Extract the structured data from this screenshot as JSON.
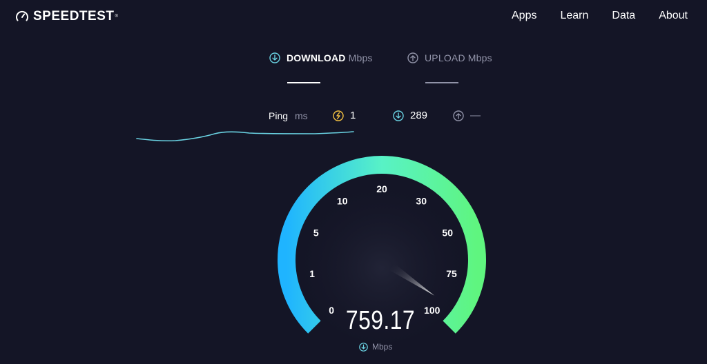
{
  "brand": {
    "name": "SPEEDTEST"
  },
  "nav": {
    "items": [
      "Apps",
      "Learn",
      "Data",
      "About"
    ]
  },
  "tabs": {
    "download": {
      "title": "DOWNLOAD",
      "unit": "Mbps",
      "icon": "download-arrow-icon"
    },
    "upload": {
      "title": "UPLOAD",
      "unit": "Mbps",
      "icon": "upload-arrow-icon"
    }
  },
  "ping": {
    "label": "Ping",
    "unit": "ms",
    "idle": {
      "value": "1",
      "icon": "ping-idle-icon",
      "color": "#f5c242"
    },
    "download": {
      "value": "289",
      "icon": "download-latency-icon",
      "color": "#6ad3e3"
    },
    "upload": {
      "value": "—",
      "icon": "upload-latency-icon",
      "color": "#9193a8"
    }
  },
  "gauge": {
    "ticks": [
      "0",
      "1",
      "5",
      "10",
      "20",
      "30",
      "50",
      "75",
      "100"
    ],
    "needle_at_tick_fraction": 0.96,
    "value": "759.17",
    "unit": "Mbps",
    "colors": {
      "start": "#1fb4ff",
      "end": "#5ff57f",
      "track": "#232538"
    }
  },
  "colors": {
    "background": "#141526",
    "accent": "#6ad3e3",
    "muted": "#9193a8"
  }
}
